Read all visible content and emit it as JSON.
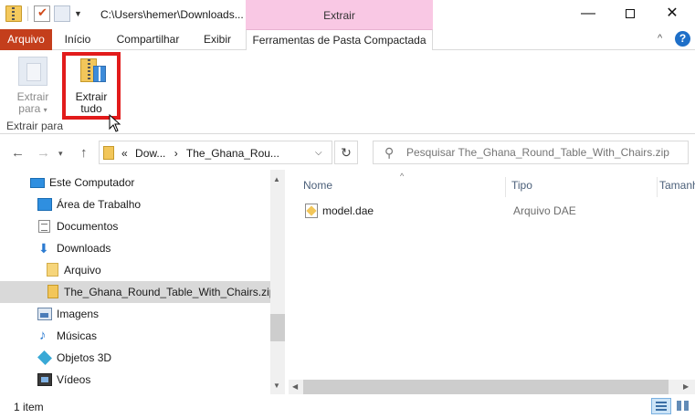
{
  "window": {
    "title": "C:\\Users\\hemer\\Downloads...",
    "context_tab_header": "Extrair",
    "minimize": "—",
    "close": "✕"
  },
  "ribbon": {
    "tabs": {
      "arquivo": "Arquivo",
      "inicio": "Início",
      "compartilhar": "Compartilhar",
      "exibir": "Exibir",
      "ferramentas": "Ferramentas de Pasta Compactada"
    },
    "help": "?",
    "collapse": "^",
    "buttons": {
      "extrair_para_line1": "Extrair",
      "extrair_para_line2": "para",
      "extrair_tudo_line1": "Extrair",
      "extrair_tudo_line2": "tudo"
    },
    "group_label": "Extrair para"
  },
  "address": {
    "overflow": "«",
    "segment1": "Dow...",
    "segment2": "The_Ghana_Rou...",
    "separator": "›"
  },
  "search": {
    "placeholder": "Pesquisar The_Ghana_Round_Table_With_Chairs.zip"
  },
  "nav_pane": {
    "items": [
      {
        "label": "Este Computador"
      },
      {
        "label": "Área de Trabalho"
      },
      {
        "label": "Documentos"
      },
      {
        "label": "Downloads"
      },
      {
        "label": "Arquivo"
      },
      {
        "label": "The_Ghana_Round_Table_With_Chairs.zip"
      },
      {
        "label": "Imagens"
      },
      {
        "label": "Músicas"
      },
      {
        "label": "Objetos 3D"
      },
      {
        "label": "Vídeos"
      }
    ],
    "selected_index": 5
  },
  "file_list": {
    "columns": {
      "name": "Nome",
      "type": "Tipo",
      "size": "Tamanho"
    },
    "rows": [
      {
        "name": "model.dae",
        "type": "Arquivo DAE"
      }
    ]
  },
  "status": {
    "count": "1 item"
  },
  "colors": {
    "arquivo_tab": "#c43e1c",
    "context_tab": "#f9c8e4",
    "highlight": "#e21b1b",
    "selection": "#d9d9d9"
  }
}
